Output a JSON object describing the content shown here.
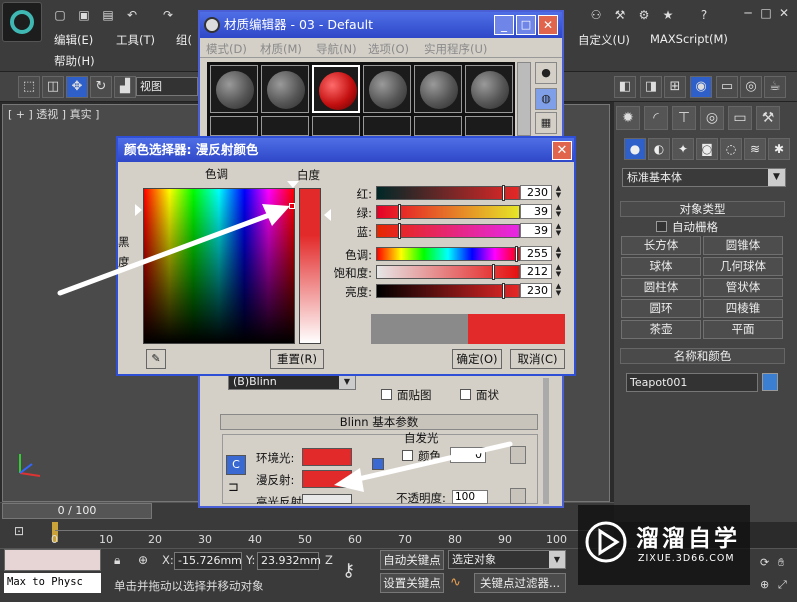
{
  "app": {
    "menus": [
      "编辑(E)",
      "工具(T)",
      "组(",
      "帮助(H)",
      "自定义(U)",
      "MAXScript(M)"
    ],
    "view_dropdown": "视图",
    "viewport_label": "[ + ] 透视 ] 真实 ]"
  },
  "command_panel": {
    "category_dropdown": "标准基本体",
    "object_type_header": "对象类型",
    "autogrid_label": "自动栅格",
    "primitives": [
      "长方体",
      "圆锥体",
      "球体",
      "几何球体",
      "圆柱体",
      "管状体",
      "圆环",
      "四棱锥",
      "茶壶",
      "平面"
    ],
    "name_color_header": "名称和颜色",
    "object_name": "Teapot001"
  },
  "timeline": {
    "frame_display": "0 / 100",
    "ticks": [
      "0",
      "10",
      "20",
      "30",
      "40",
      "50",
      "60",
      "70",
      "80",
      "90",
      "100"
    ]
  },
  "status": {
    "maxscript": "Max to Physc",
    "x_value": "-15.726mm",
    "y_value": "23.932mm",
    "x_label": "X:",
    "y_label": "Y:",
    "z_label": "Z",
    "auto_key": "自动关键点",
    "set_key": "设置关键点",
    "selected_object": "选定对象",
    "key_filters": "关键点过滤器...",
    "prompt": "单击并拖动以选择并移动对象"
  },
  "watermark": {
    "brand": "溜溜自学",
    "url": "ZIXUE.3D66.COM"
  },
  "material_editor": {
    "title": "材质编辑器 - 03 - Default",
    "menus": [
      "模式(D)",
      "材质(M)",
      "导航(N)",
      "选项(O)",
      "实用程序(U)"
    ],
    "shader": "(B)Blinn",
    "face_map_label": "面贴图",
    "faceted_label": "面状",
    "blinn_header": "Blinn 基本参数",
    "self_illum_label": "自发光",
    "color_label": "颜色",
    "self_illum_value": "0",
    "ambient_label": "环境光:",
    "diffuse_label": "漫反射:",
    "specular_label": "高光反射:",
    "opacity_label": "不透明度:",
    "opacity_value": "100"
  },
  "color_picker": {
    "title": "颜色选择器: 漫反射颜色",
    "hue_label": "色调",
    "whiteness_label": "白度",
    "blackness_label": "黑度",
    "red_label": "红:",
    "green_label": "绿:",
    "blue_label": "蓝:",
    "hue_s_label": "色调:",
    "sat_label": "饱和度:",
    "value_label": "亮度:",
    "red": "230",
    "green": "39",
    "blue": "39",
    "hue": "255",
    "saturation": "212",
    "brightness": "230",
    "reset_button": "重置(R)",
    "ok_button": "确定(O)",
    "cancel_button": "取消(C)"
  },
  "colors": {
    "selected_color": "#e62727",
    "original_color": "#8a8a8a",
    "titlebar": "#2e47c8",
    "object_color": "#3a7fd1"
  }
}
